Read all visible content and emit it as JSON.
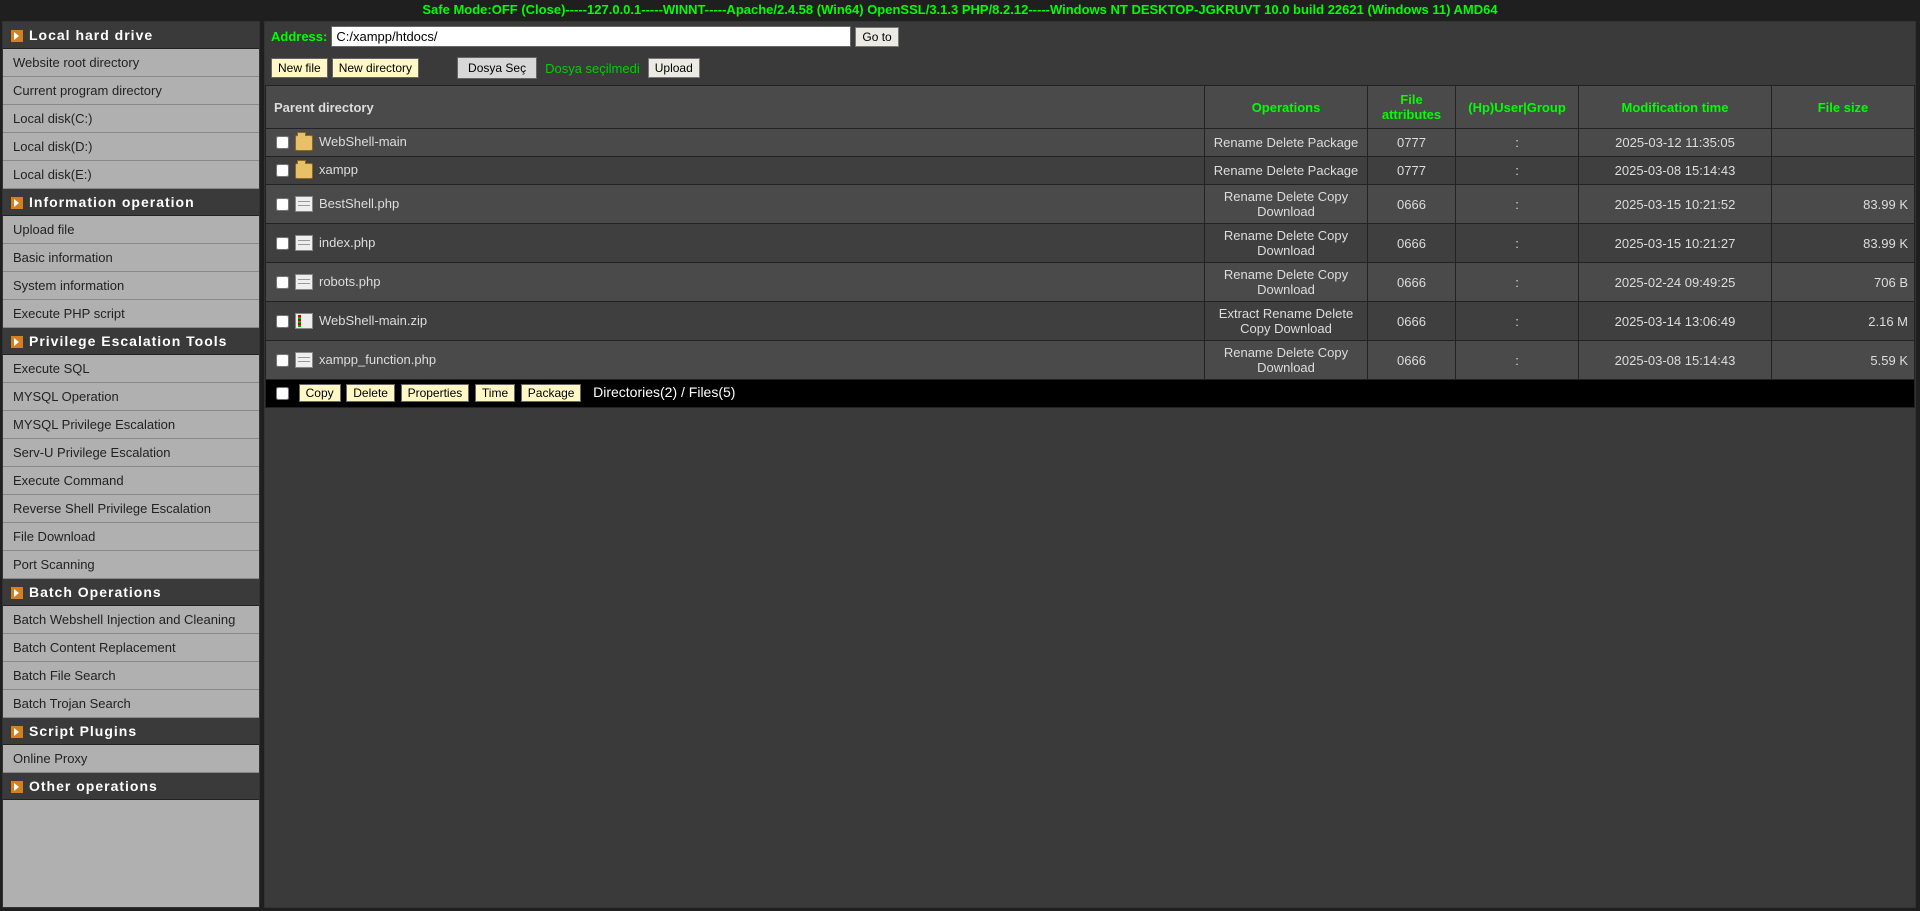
{
  "banner": "Safe Mode:OFF (Close)-----127.0.0.1-----WINNT-----Apache/2.4.58 (Win64) OpenSSL/3.1.3 PHP/8.2.12-----Windows NT DESKTOP-JGKRUVT 10.0 build 22621 (Windows 11) AMD64",
  "sidebar": {
    "sections": [
      {
        "title": "Local hard drive",
        "items": [
          "Website root directory",
          "Current program directory",
          "Local disk(C:)",
          "Local disk(D:)",
          "Local disk(E:)"
        ]
      },
      {
        "title": "Information operation",
        "items": [
          "Upload file",
          "Basic information",
          "System information",
          "Execute PHP script"
        ]
      },
      {
        "title": "Privilege Escalation Tools",
        "items": [
          "Execute SQL",
          "MYSQL Operation",
          "MYSQL Privilege Escalation",
          "Serv-U Privilege Escalation",
          "Execute Command",
          "Reverse Shell Privilege Escalation",
          "File Download",
          "Port Scanning"
        ]
      },
      {
        "title": "Batch Operations",
        "items": [
          "Batch Webshell Injection and Cleaning",
          "Batch Content Replacement",
          "Batch File Search",
          "Batch Trojan Search"
        ]
      },
      {
        "title": "Script Plugins",
        "items": [
          "Online Proxy"
        ]
      },
      {
        "title": "Other operations",
        "items": []
      }
    ]
  },
  "address": {
    "label": "Address:",
    "value": "C:/xampp/htdocs/",
    "go": "Go to"
  },
  "toolbar": {
    "new_file": "New file",
    "new_directory": "New directory",
    "choose_file": "Dosya Seç",
    "no_file": "Dosya seçilmedi",
    "upload": "Upload"
  },
  "headers": {
    "parent": "Parent directory",
    "ops": "Operations",
    "attr": "File attributes",
    "user": "(Hp)User|Group",
    "time": "Modification time",
    "size": "File size"
  },
  "rows": [
    {
      "type": "folder",
      "name": "WebShell-main",
      "ops": "Rename Delete Package",
      "attr": "0777",
      "user": ":",
      "time": "2025-03-12 11:35:05",
      "size": ""
    },
    {
      "type": "folder",
      "name": "xampp",
      "ops": "Rename Delete Package",
      "attr": "0777",
      "user": ":",
      "time": "2025-03-08 15:14:43",
      "size": ""
    },
    {
      "type": "file",
      "name": "BestShell.php",
      "ops": "Rename Delete Copy Download",
      "attr": "0666",
      "user": ":",
      "time": "2025-03-15 10:21:52",
      "size": "83.99 K"
    },
    {
      "type": "file",
      "name": "index.php",
      "ops": "Rename Delete Copy Download",
      "attr": "0666",
      "user": ":",
      "time": "2025-03-15 10:21:27",
      "size": "83.99 K"
    },
    {
      "type": "file",
      "name": "robots.php",
      "ops": "Rename Delete Copy Download",
      "attr": "0666",
      "user": ":",
      "time": "2025-02-24 09:49:25",
      "size": "706 B"
    },
    {
      "type": "zip",
      "name": "WebShell-main.zip",
      "ops": "Extract Rename Delete Copy Download",
      "attr": "0666",
      "user": ":",
      "time": "2025-03-14 13:06:49",
      "size": "2.16 M"
    },
    {
      "type": "file",
      "name": "xampp_function.php",
      "ops": "Rename Delete Copy Download",
      "attr": "0666",
      "user": ":",
      "time": "2025-03-08 15:14:43",
      "size": "5.59 K"
    }
  ],
  "footer": {
    "copy": "Copy",
    "delete": "Delete",
    "properties": "Properties",
    "time": "Time",
    "package": "Package",
    "summary": "Directories(2) / Files(5)"
  }
}
